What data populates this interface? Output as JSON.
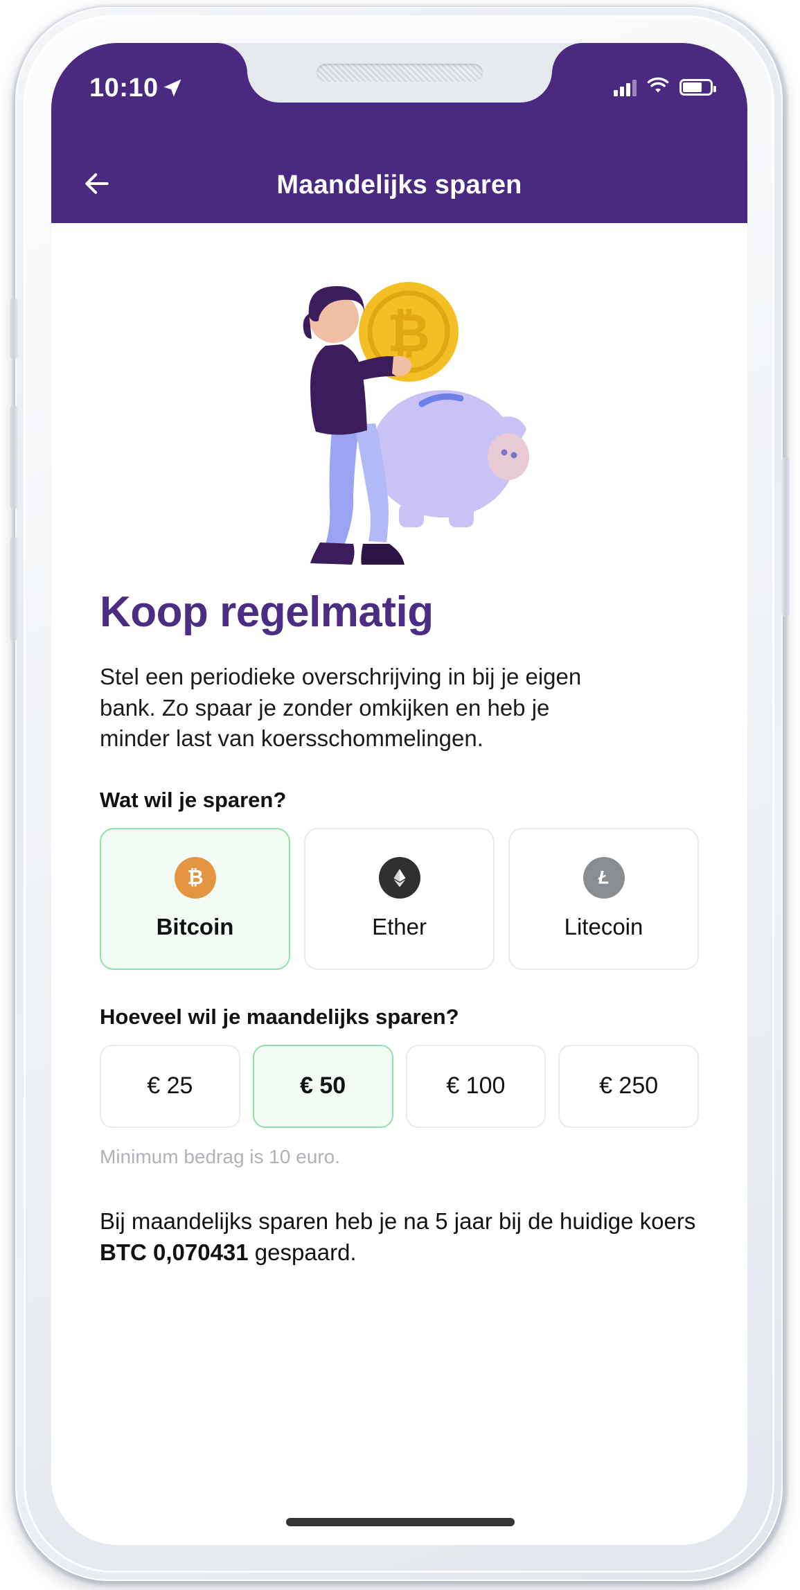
{
  "status_bar": {
    "time": "10:10",
    "location_icon": "location-arrow-icon",
    "signal_icon": "cellular-signal-icon",
    "wifi_icon": "wifi-icon",
    "battery_icon": "battery-icon"
  },
  "header": {
    "back_icon": "arrow-left-icon",
    "title": "Maandelijks sparen",
    "background_color": "#4a2a80"
  },
  "illustration": {
    "name": "person-with-bitcoin-coin-and-piggy-bank-illustration",
    "coin_symbol": "₿",
    "coin_color": "#F4BE25",
    "piggy_color": "#C5C0F2",
    "person_hair_color": "#3B1D5E",
    "person_pants_color": "#9AA4F2"
  },
  "main": {
    "title": "Koop regelmatig",
    "title_color": "#4b2d83",
    "lede": "Stel een periodieke overschrijving in bij je eigen bank. Zo spaar je zonder omkijken en heb je minder last van koersschommelingen.",
    "coin_question": "Wat wil je sparen?",
    "coins": [
      {
        "label": "Bitcoin",
        "icon": "bitcoin-icon",
        "symbol": "₿",
        "icon_color": "#e49542",
        "selected": true
      },
      {
        "label": "Ether",
        "icon": "ethereum-icon",
        "symbol": "◆",
        "icon_color": "#2f3032",
        "selected": false
      },
      {
        "label": "Litecoin",
        "icon": "litecoin-icon",
        "symbol": "Ł",
        "icon_color": "#8a8d90",
        "selected": false
      }
    ],
    "amount_question": "Hoeveel wil je maandelijks sparen?",
    "amounts": [
      {
        "label": "€ 25",
        "selected": false
      },
      {
        "label": "€ 50",
        "selected": true
      },
      {
        "label": "€ 100",
        "selected": false
      },
      {
        "label": "€ 250",
        "selected": false
      }
    ],
    "minimum_hint": "Minimum bedrag is 10 euro.",
    "summary_prefix": "Bij maandelijks sparen heb je na 5 jaar bij de huidige koers ",
    "summary_amount": "BTC 0,070431",
    "summary_suffix": " gespaard.",
    "selected_accent_border": "#8fe0a9",
    "selected_accent_bg": "#f3fbf5"
  }
}
